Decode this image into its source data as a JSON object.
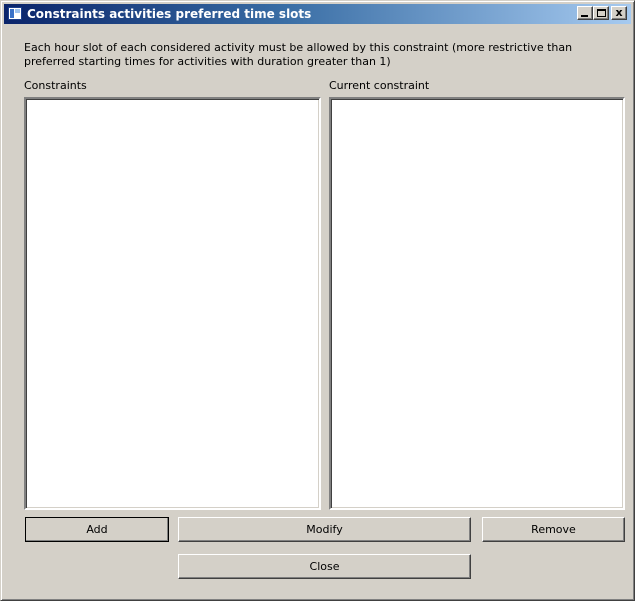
{
  "window": {
    "title": "Constraints activities preferred time slots",
    "icons": {
      "app": "app-window-icon",
      "minimize": "minimize-icon",
      "maximize": "maximize-icon",
      "close": "close-icon"
    },
    "close_glyph": "x",
    "title_gradient": [
      "#0a246a",
      "#a6caf0"
    ],
    "face_color": "#d4d0c8"
  },
  "description": "Each hour slot of each considered activity must be allowed by this constraint (more restrictive than\npreferred starting times for activities with duration greater than 1)",
  "constraints": {
    "label": "Constraints",
    "items": []
  },
  "current_constraint": {
    "label": "Current constraint",
    "text": ""
  },
  "buttons": {
    "add": "Add",
    "modify": "Modify",
    "remove": "Remove",
    "close": "Close"
  }
}
